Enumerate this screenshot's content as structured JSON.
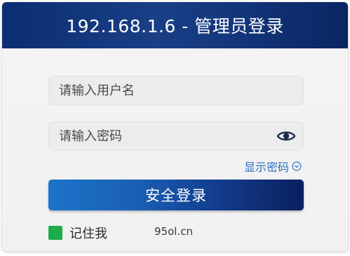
{
  "header": {
    "title": "192.168.1.6 - 管理员登录"
  },
  "form": {
    "username_placeholder": "请输入用户名",
    "username_value": "",
    "password_placeholder": "请输入密码",
    "password_value": "",
    "show_password_label": "显示密码",
    "login_button_label": "安全登录",
    "remember_me_label": "记住我",
    "remember_me_checked": true
  },
  "watermark": {
    "text": "95ol.cn"
  },
  "icons": {
    "password_toggle": "eye-icon",
    "show_password_hint": "circle-chevron-down-icon"
  },
  "colors": {
    "header": "#123479",
    "button_start": "#1b74c9",
    "button_end": "#0b1f5e",
    "link": "#2f6fc4",
    "checkbox": "#1eac4b"
  }
}
